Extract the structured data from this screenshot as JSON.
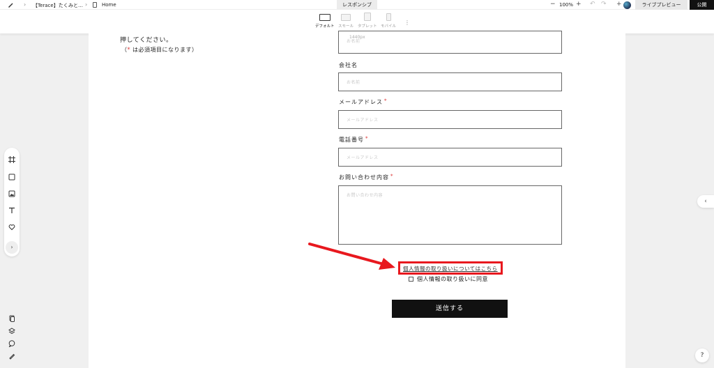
{
  "topbar": {
    "breadcrumb_project": "【Terace】たくみと…",
    "breadcrumb_page": "Home",
    "responsive_tab": "レスポンシブ",
    "zoom": "100%",
    "live_preview": "ライブプレビュー",
    "publish": "公開"
  },
  "devices": [
    {
      "label": "デフォルト",
      "active": true
    },
    {
      "label": "スモール",
      "active": false
    },
    {
      "label": "タブレット",
      "active": false
    },
    {
      "label": "モバイル",
      "active": false
    }
  ],
  "page": {
    "intro_line1": "押してください。",
    "intro_line2_prefix": "（",
    "intro_line2_star": "*",
    "intro_line2_suffix": " は必須項目になります）",
    "ghost_width_label": "1440px",
    "fields": [
      {
        "label": "",
        "placeholder": "お名前",
        "required": false
      },
      {
        "label": "会社名",
        "placeholder": "お名前",
        "required": false
      },
      {
        "label": "メールアドレス",
        "placeholder": "メールアドレス",
        "required": true
      },
      {
        "label": "電話番号",
        "placeholder": "メールアドレス",
        "required": true
      },
      {
        "label": "お問い合わせ内容",
        "placeholder": "お問い合わせ内容",
        "required": true
      }
    ],
    "required_star": "*",
    "privacy_link": "個人情報の取り扱いについてはこちら",
    "consent_label": "個人情報の取り扱いに同意",
    "submit": "送信する"
  },
  "annotation": {
    "color": "#e8181e"
  },
  "help_label": "?"
}
